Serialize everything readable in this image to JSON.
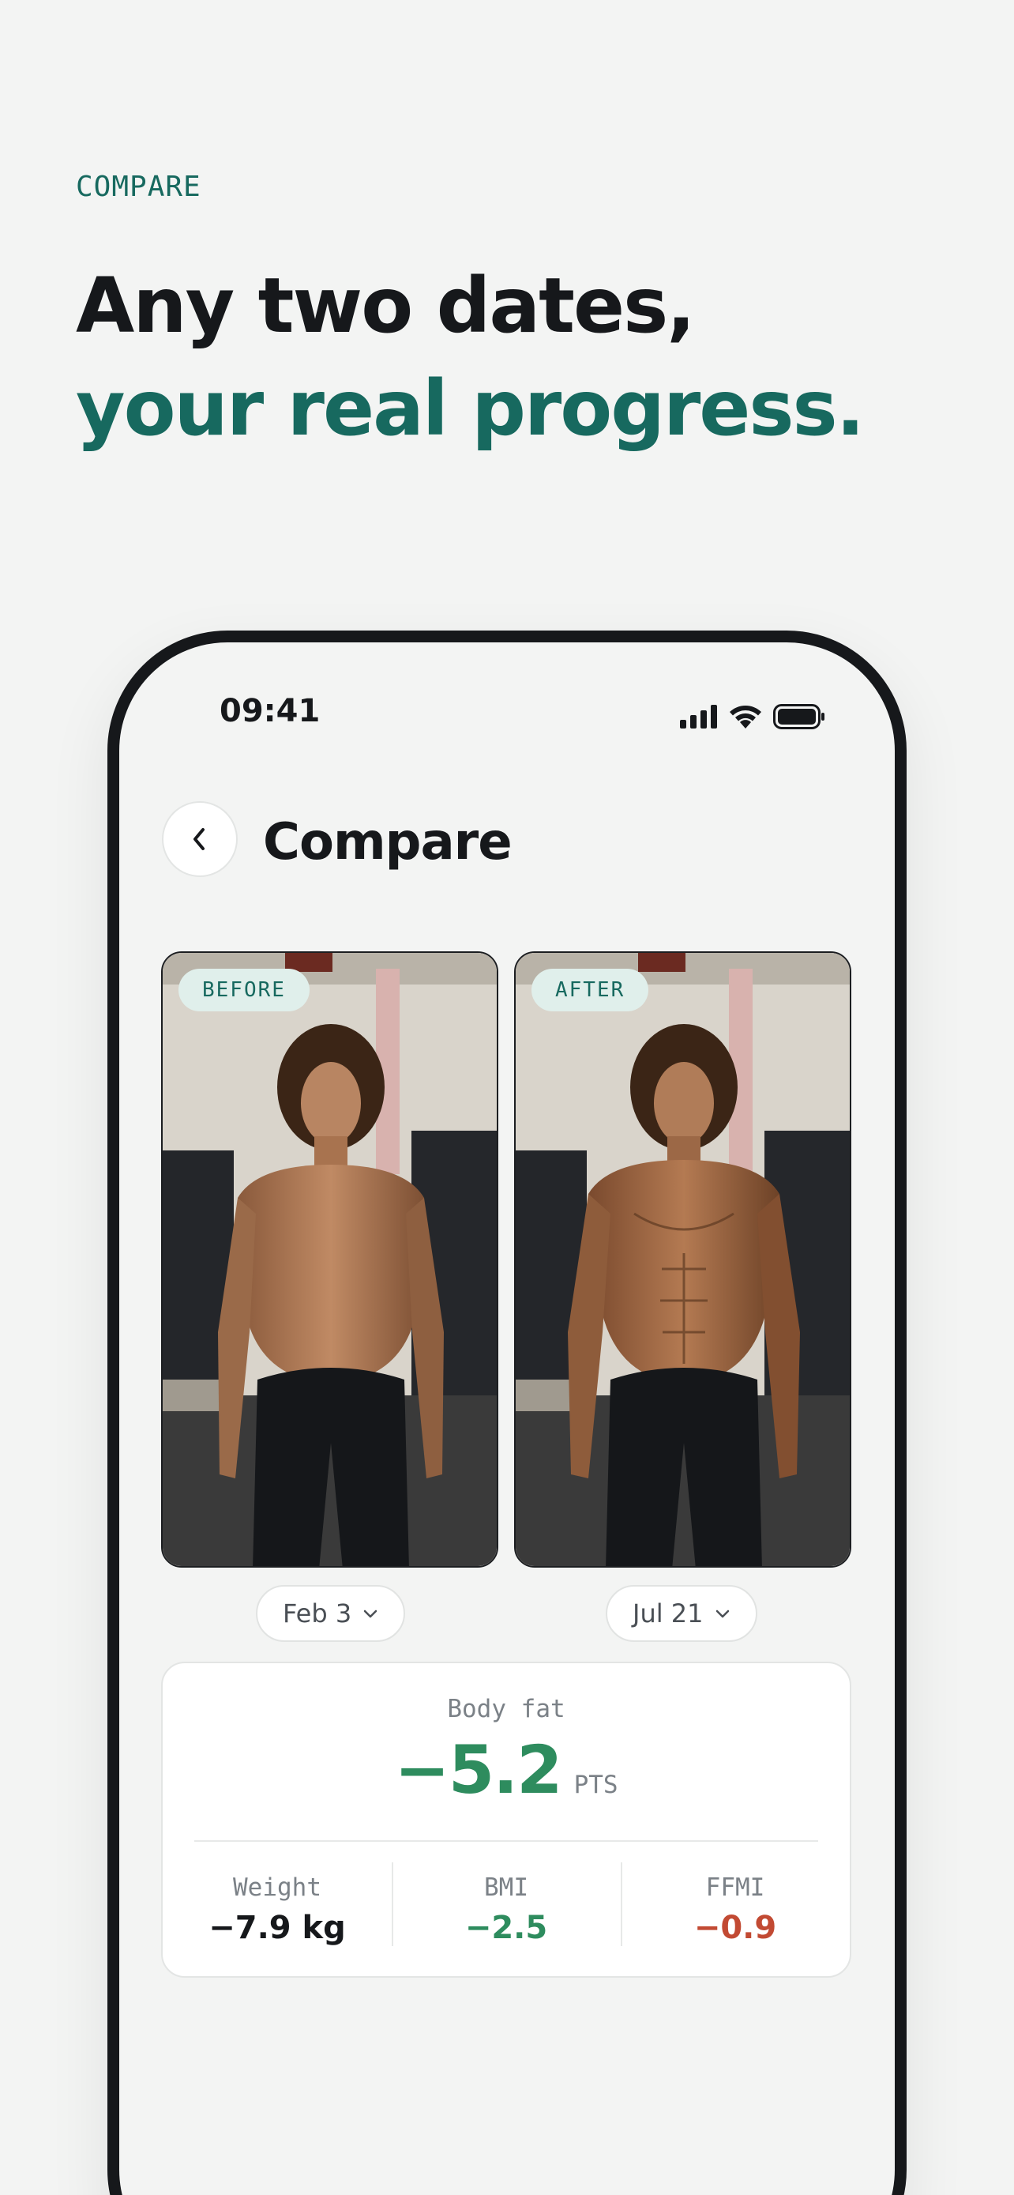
{
  "eyebrow": "COMPARE",
  "headline": {
    "line1": "Any two dates,",
    "line2": "your real progress."
  },
  "status_bar": {
    "time": "09:41",
    "icons": [
      "signal-icon",
      "wifi-icon",
      "battery-icon"
    ]
  },
  "screen": {
    "title": "Compare",
    "back_icon": "chevron-left-icon"
  },
  "photos": {
    "before": {
      "tag": "BEFORE",
      "date": "Feb 3"
    },
    "after": {
      "tag": "AFTER",
      "date": "Jul 21"
    }
  },
  "stats": {
    "primary": {
      "label": "Body fat",
      "value": "−5.2",
      "unit": "PTS"
    },
    "metrics": [
      {
        "label": "Weight",
        "value": "−7.9 kg"
      },
      {
        "label": "BMI",
        "value": "−2.5"
      },
      {
        "label": "FFMI",
        "value": "−0.9"
      }
    ]
  },
  "colors": {
    "accent": "#17695f",
    "positive": "#2e8c5e",
    "negative": "#c24a33",
    "background": "#f3f4f3"
  }
}
